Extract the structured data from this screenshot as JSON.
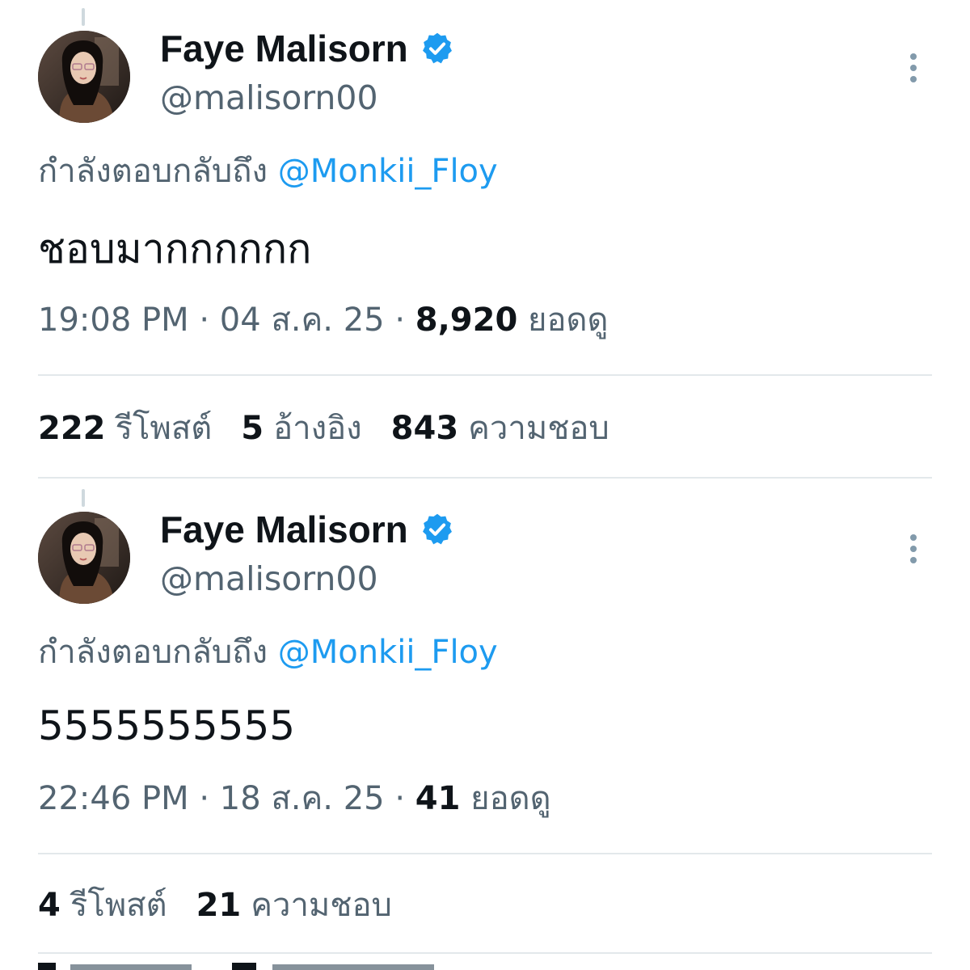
{
  "posts": [
    {
      "author": {
        "display_name": "Faye Malisorn",
        "handle": "@malisorn00",
        "verified": true
      },
      "reply_prefix": "กำลังตอบกลับถึง",
      "reply_to": "@Monkii_Floy",
      "text": "ชอบมากกกกกก",
      "time": "19:08 PM",
      "date": "04 ส.ค. 25",
      "views": "8,920",
      "views_label": "ยอดดู",
      "stats": [
        {
          "count": "222",
          "label": "รีโพสต์"
        },
        {
          "count": "5",
          "label": "อ้างอิง"
        },
        {
          "count": "843",
          "label": "ความชอบ"
        }
      ]
    },
    {
      "author": {
        "display_name": "Faye Malisorn",
        "handle": "@malisorn00",
        "verified": true
      },
      "reply_prefix": "กำลังตอบกลับถึง",
      "reply_to": "@Monkii_Floy",
      "text": "5555555555",
      "time": "22:46 PM",
      "date": "18 ส.ค. 25",
      "views": "41",
      "views_label": "ยอดดู",
      "stats": [
        {
          "count": "4",
          "label": "รีโพสต์"
        },
        {
          "count": "21",
          "label": "ความชอบ"
        }
      ]
    }
  ],
  "meta_separator": "·",
  "icons": {
    "verified": "verified-badge-icon",
    "more": "more-options-icon"
  },
  "colors": {
    "accent": "#1d9bf0",
    "text_primary": "#0f1419",
    "text_secondary": "#536471",
    "divider": "#e3e8eb"
  }
}
